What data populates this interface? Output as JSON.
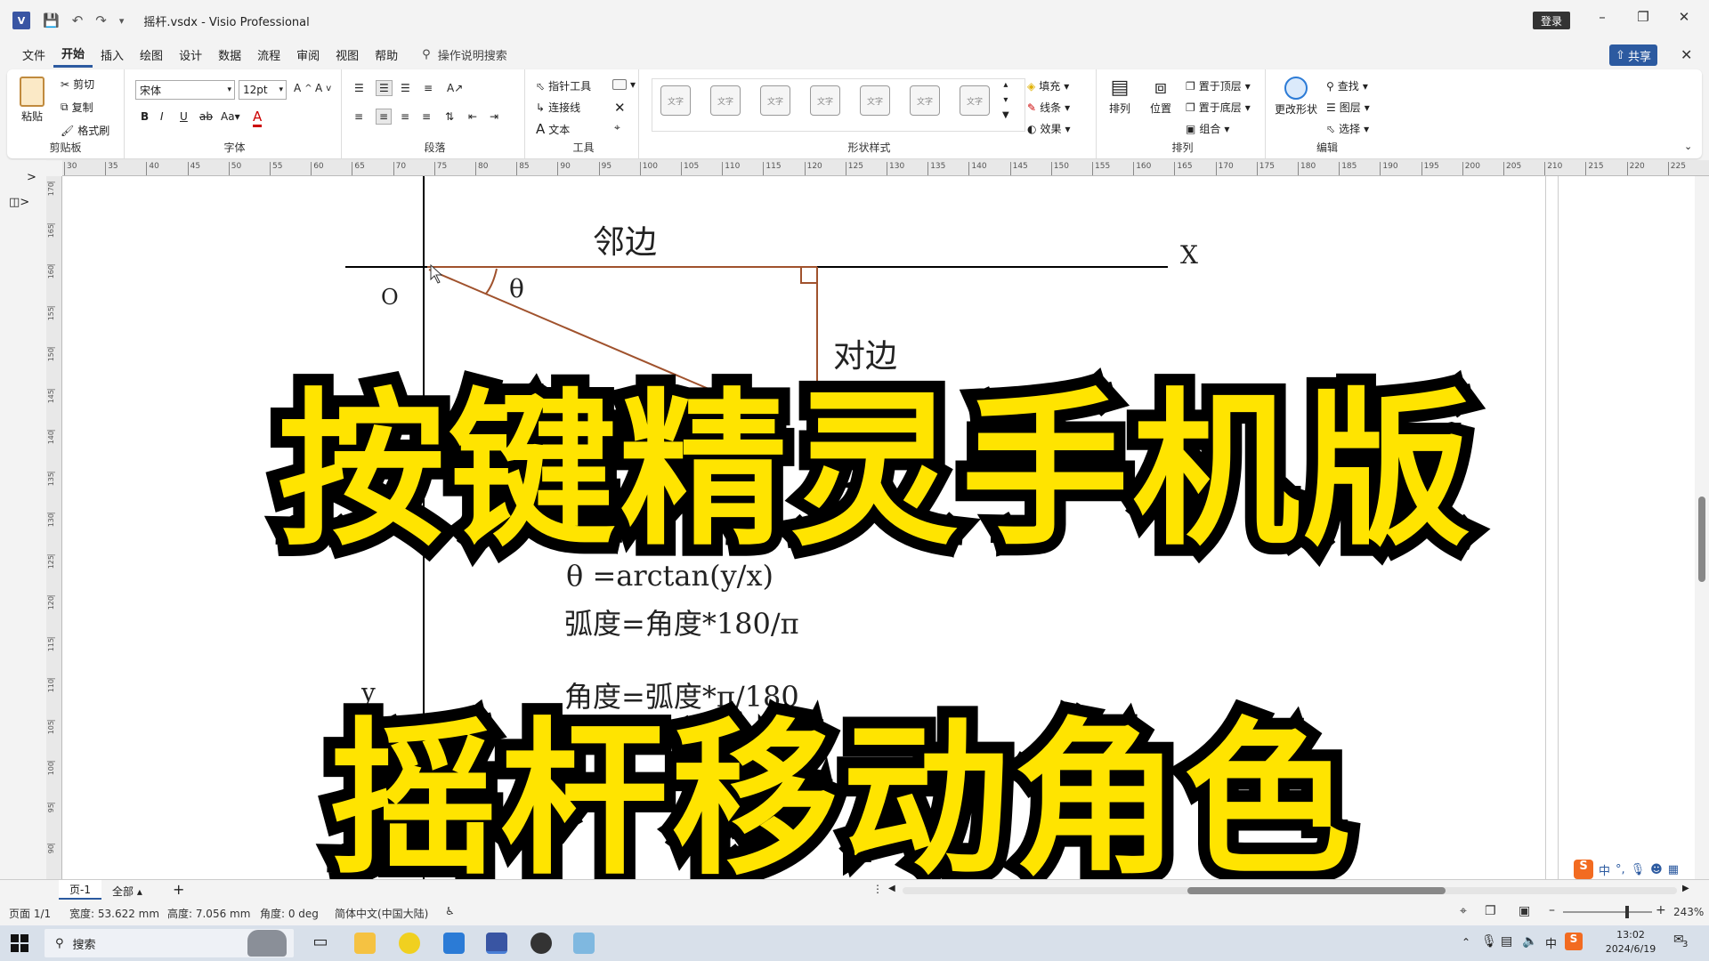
{
  "titlebar": {
    "app_icon": "V",
    "filename": "摇杆.vsdx",
    "separator": "-",
    "app_name": "Visio Professional",
    "login_label": "登录"
  },
  "menubar": {
    "items": [
      "文件",
      "开始",
      "插入",
      "绘图",
      "设计",
      "数据",
      "流程",
      "审阅",
      "视图",
      "帮助"
    ],
    "active": "开始",
    "search_hint": "操作说明搜索",
    "share_label": "共享"
  },
  "ribbon": {
    "clipboard": {
      "paste": "粘贴",
      "cut": "剪切",
      "copy": "复制",
      "format_painter": "格式刷",
      "label": "剪贴板"
    },
    "font": {
      "family": "宋体",
      "size": "12pt",
      "label": "字体"
    },
    "paragraph": {
      "label": "段落"
    },
    "tools": {
      "pointer": "指针工具",
      "connector": "连接线",
      "text": "文本",
      "label": "工具"
    },
    "shape_styles": {
      "sample": "文字",
      "fill": "填充",
      "line": "线条",
      "effects": "效果",
      "label": "形状样式"
    },
    "arrange": {
      "arrange": "排列",
      "position": "位置",
      "bring_front": "置于顶层",
      "send_back": "置于底层",
      "group": "组合",
      "label": "排列"
    },
    "editing": {
      "change_shape": "更改形状",
      "find": "查找",
      "layers": "图层",
      "select": "选择",
      "label": "编辑"
    }
  },
  "ruler": {
    "top_ticks": [
      "30",
      "35",
      "40",
      "45",
      "50",
      "55",
      "60",
      "65",
      "70",
      "75",
      "80",
      "85",
      "90",
      "95",
      "100",
      "105",
      "110",
      "115",
      "120",
      "125",
      "130",
      "135",
      "140",
      "145",
      "150",
      "155",
      "160",
      "165",
      "170",
      "175",
      "180",
      "185",
      "190",
      "195",
      "200",
      "205",
      "210",
      "215",
      "220",
      "225"
    ],
    "left_ticks": [
      "170",
      "165",
      "160",
      "155",
      "150",
      "145",
      "140",
      "135",
      "130",
      "125",
      "120",
      "115",
      "110",
      "105",
      "100",
      "95",
      "90"
    ]
  },
  "diagram": {
    "adjacent": "邻边",
    "opposite": "对边",
    "x_axis": "X",
    "y_axis": "y",
    "origin": "O",
    "theta": "θ",
    "formula1": "θ =arctan(y/x)",
    "formula2": "弧度=角度*180/π",
    "formula3": "角度=弧度*π/180",
    "partial": "θ = x"
  },
  "overlay": {
    "line1": "按键精灵手机版",
    "line2": "摇杆移动角色"
  },
  "pagebar": {
    "page_tab": "页-1",
    "all_label": "全部"
  },
  "statusbar": {
    "page": "页面 1/1",
    "width": "宽度: 53.622 mm",
    "height": "高度: 7.056 mm",
    "angle": "角度: 0 deg",
    "language": "简体中文(中国大陆)",
    "zoom": "243%"
  },
  "taskbar": {
    "search": "搜索",
    "time": "13:02",
    "date": "2024/6/19",
    "ime": "中",
    "notification_count": "3"
  },
  "colors": {
    "accent": "#2c5aa0",
    "triangle": "#a0522d",
    "overlay_fill": "#ffe400"
  }
}
